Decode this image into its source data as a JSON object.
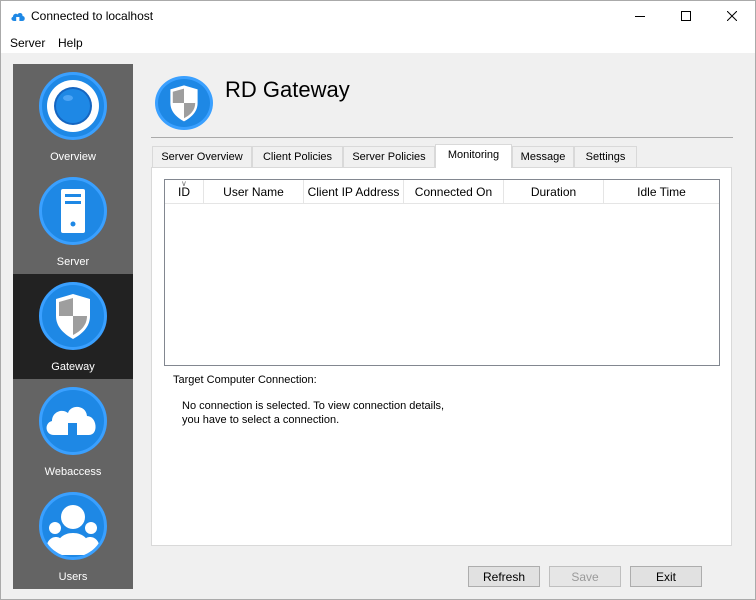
{
  "window": {
    "title": "Connected to localhost",
    "icon": "cloud-icon",
    "accent_color": "#1e88e5"
  },
  "menu": {
    "items": [
      {
        "label": "Server"
      },
      {
        "label": "Help"
      }
    ]
  },
  "sidebar": {
    "items": [
      {
        "label": "Overview",
        "icon": "overview-icon",
        "active": false
      },
      {
        "label": "Server",
        "icon": "server-icon",
        "active": false
      },
      {
        "label": "Gateway",
        "icon": "shield-icon",
        "active": true
      },
      {
        "label": "Webaccess",
        "icon": "cloud-icon",
        "active": false
      },
      {
        "label": "Users",
        "icon": "users-icon",
        "active": false
      }
    ]
  },
  "header": {
    "title": "RD Gateway",
    "icon": "shield-icon"
  },
  "tabs": [
    {
      "label": "Server Overview",
      "active": false
    },
    {
      "label": "Client Policies",
      "active": false
    },
    {
      "label": "Server Policies",
      "active": false
    },
    {
      "label": "Monitoring",
      "active": true
    },
    {
      "label": "Message",
      "active": false
    },
    {
      "label": "Settings",
      "active": false
    }
  ],
  "monitoring": {
    "columns": [
      "ID",
      "User Name",
      "Client IP Address",
      "Connected On",
      "Duration",
      "Idle Time"
    ],
    "rows": [],
    "target_label": "Target Computer Connection:",
    "target_info_line1": "No connection is selected. To view connection details,",
    "target_info_line2": "you have to select a connection."
  },
  "buttons": {
    "refresh": "Refresh",
    "save": "Save",
    "exit": "Exit"
  }
}
